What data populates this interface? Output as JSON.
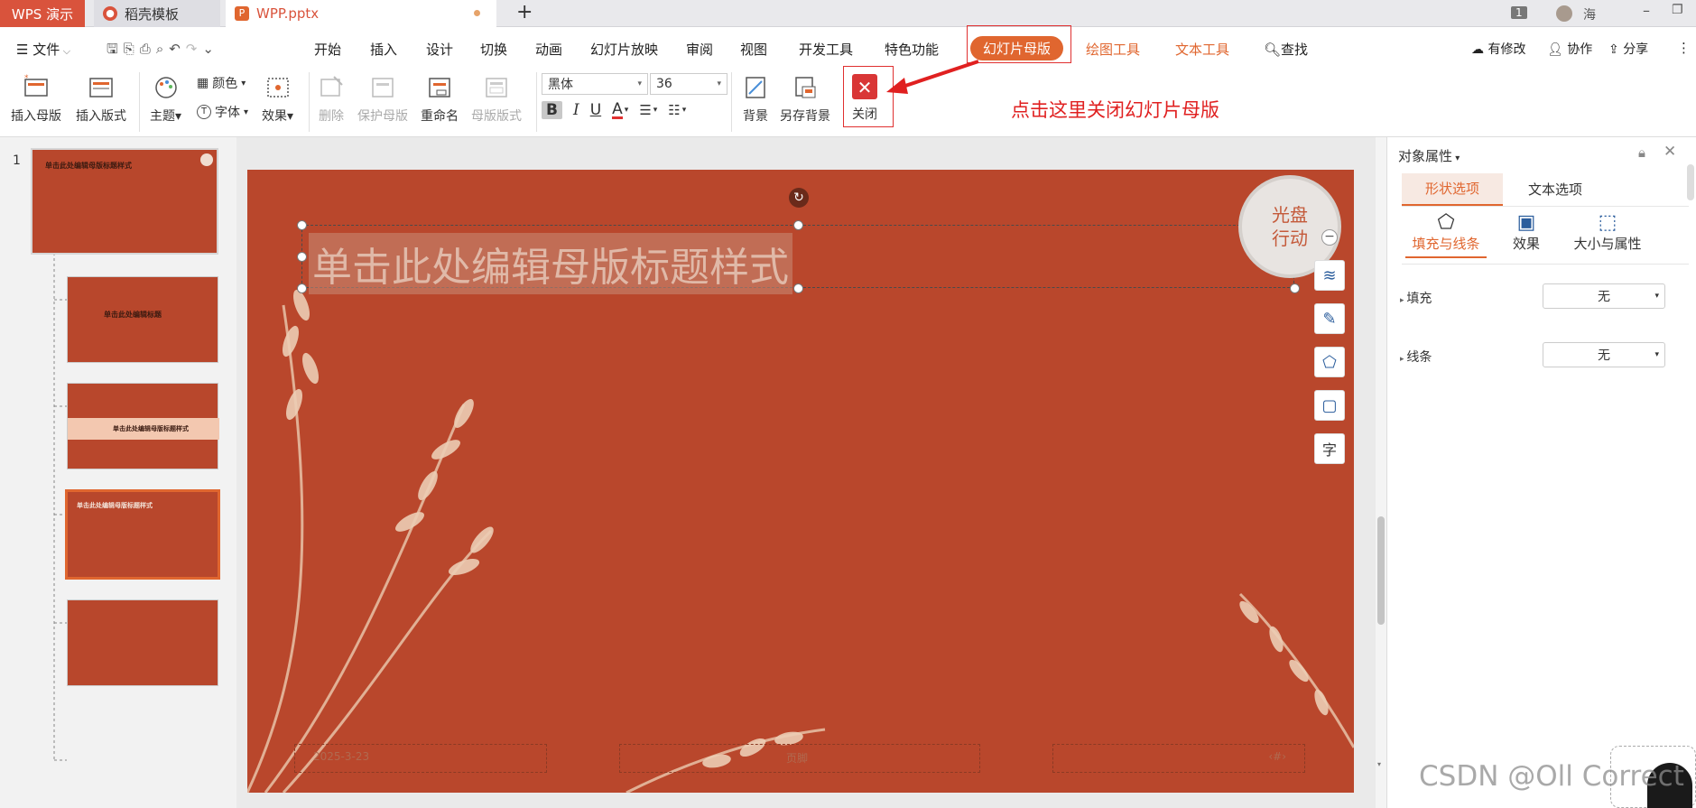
{
  "titlebar": {
    "app_tab": "WPS 演示",
    "template_tab": "稻壳模板",
    "file_tab": "WPP.pptx",
    "badge": "1",
    "user_name": "海"
  },
  "menu": {
    "file": "文件",
    "items": [
      "开始",
      "插入",
      "设计",
      "切换",
      "动画",
      "幻灯片放映",
      "审阅",
      "视图",
      "开发工具",
      "特色功能"
    ],
    "active": "幻灯片母版",
    "drawing_tools": "绘图工具",
    "text_tools": "文本工具",
    "search": "查找",
    "modified": "有修改",
    "collaborate": "协作",
    "share": "分享"
  },
  "ribbon": {
    "insert_master": "插入母版",
    "insert_layout": "插入版式",
    "theme": "主题",
    "color": "颜色",
    "font": "字体",
    "effect": "效果",
    "delete": "删除",
    "protect_master": "保护母版",
    "rename": "重命名",
    "master_layout": "母版版式",
    "font_name": "黑体",
    "font_size": "36",
    "background": "背景",
    "save_background": "另存背景",
    "close": "关闭"
  },
  "annotation": "点击这里关闭幻灯片母版",
  "slide_panel": {
    "slide_number": "1",
    "thumb1_title": "单击此处编辑母版标题样式",
    "thumb2_title": "单击此处编辑标题",
    "thumb3_title": "单击此处编辑母版标题样式",
    "thumb4_title": "单击此处编辑母版标题样式"
  },
  "slide": {
    "title_placeholder": "单击此处编辑母版标题样式",
    "logo_line1": "光盘",
    "logo_line2": "行动",
    "date": "2025-3-23",
    "footer": "页脚",
    "page_num": "‹#›"
  },
  "props_panel": {
    "title": "对象属性",
    "tab_shape": "形状选项",
    "tab_text": "文本选项",
    "sub_fill_line": "填充与线条",
    "sub_effect": "效果",
    "sub_size": "大小与属性",
    "fill_label": "填充",
    "fill_value": "无",
    "line_label": "线条",
    "line_value": "无"
  },
  "watermark": "CSDN @Oll Correct",
  "colors": {
    "accent": "#e0662f",
    "slide_bg": "#b9472c",
    "annotation": "#e02020"
  }
}
